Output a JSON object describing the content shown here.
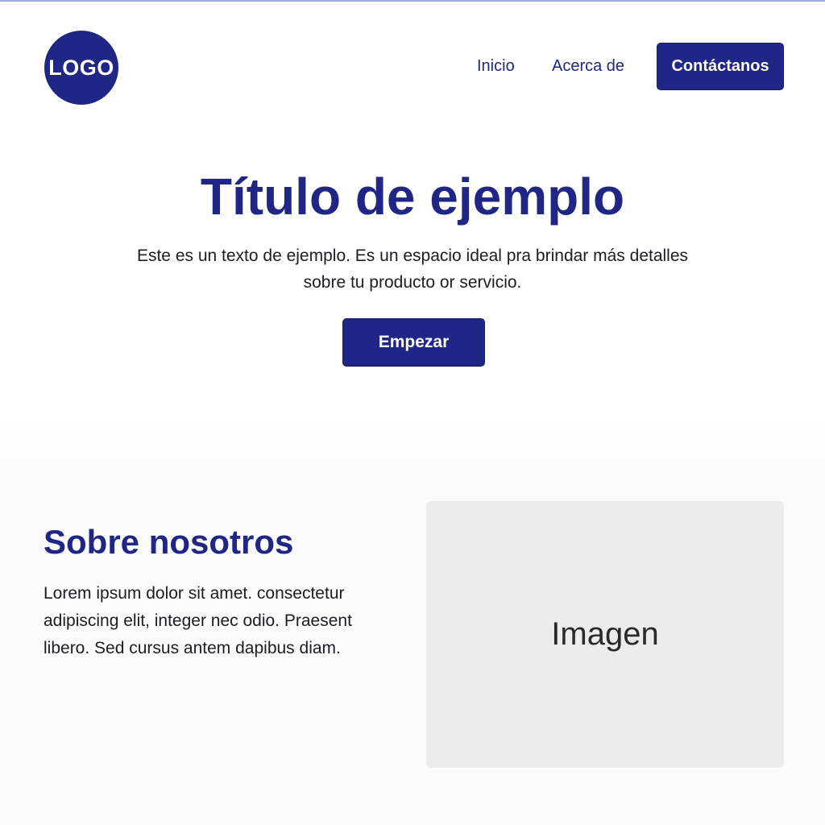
{
  "header": {
    "logo_text": "LOGO",
    "nav": {
      "home": "Inicio",
      "about": "Acerca de",
      "contact": "Contáctanos"
    }
  },
  "hero": {
    "title": "Título de ejemplo",
    "text": "Este es un texto de ejemplo. Es un espacio ideal pra brindar más detalles sobre tu producto or servicio.",
    "button_label": "Empezar"
  },
  "about": {
    "title": "Sobre nosotros",
    "text": "Lorem ipsum dolor sit amet. consectetur adipiscing elit, integer nec odio. Praesent libero. Sed cursus antem dapibus diam.",
    "image_label": "Imagen"
  },
  "colors": {
    "brand": "#1f2686",
    "background": "#ffffff",
    "image_placeholder": "#ececec"
  }
}
